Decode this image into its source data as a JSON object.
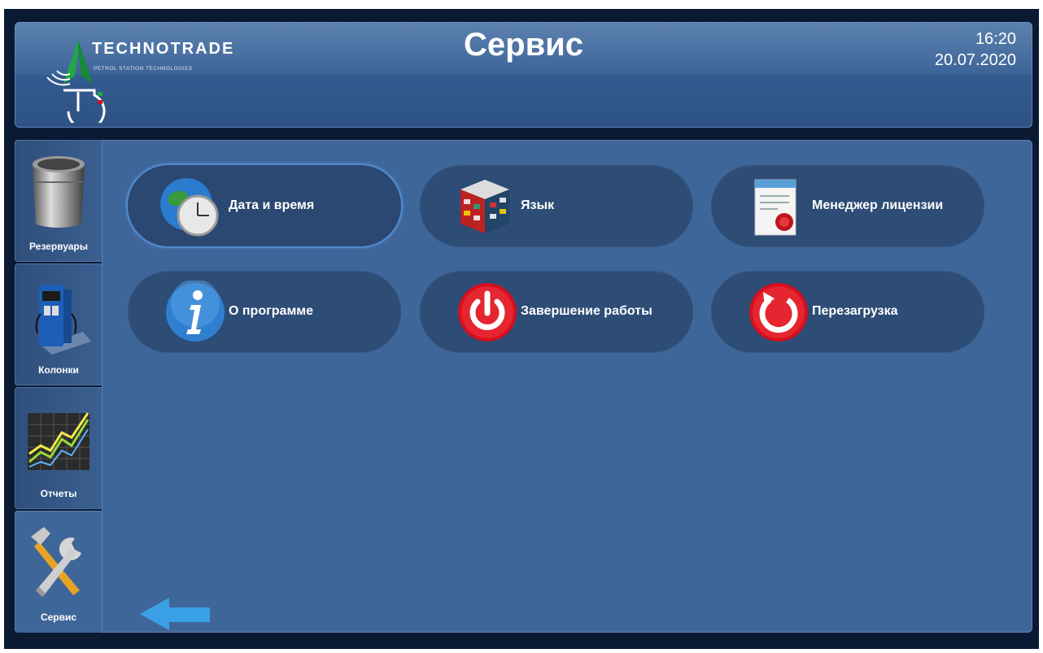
{
  "header": {
    "brand": "TECHNOTRADE",
    "brand_sub": "PETROL STATION TECHNOLOGIES",
    "title": "Сервис",
    "time": "16:20",
    "date": "20.07.2020"
  },
  "sidebar": {
    "items": [
      {
        "label": "Резервуары",
        "icon": "tank-icon"
      },
      {
        "label": "Колонки",
        "icon": "fuel-dispenser-icon"
      },
      {
        "label": "Отчеты",
        "icon": "chart-icon"
      },
      {
        "label": "Сервис",
        "icon": "tools-icon",
        "active": true
      }
    ]
  },
  "menu": {
    "items": [
      {
        "label": "Дата и время",
        "icon": "globe-clock-icon",
        "selected": true
      },
      {
        "label": "Язык",
        "icon": "flags-cube-icon"
      },
      {
        "label": "Менеджер лицензии",
        "icon": "certificate-icon"
      },
      {
        "label": "О программе",
        "icon": "info-icon"
      },
      {
        "label": "Завершение работы",
        "icon": "power-icon"
      },
      {
        "label": "Перезагрузка",
        "icon": "restart-icon"
      }
    ]
  },
  "back_icon": "back-arrow-icon",
  "colors": {
    "accent": "#3f6699",
    "danger": "#d40f1e",
    "info": "#2f7fd0"
  }
}
